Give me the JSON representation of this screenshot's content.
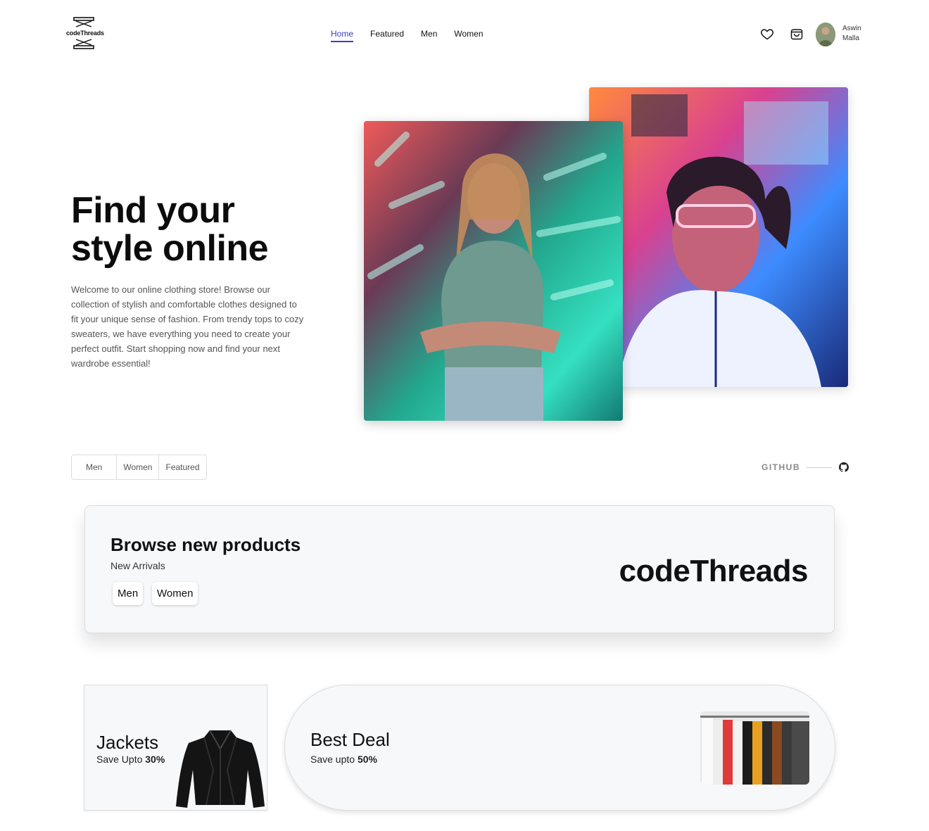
{
  "header": {
    "logo_text": "codeThreads",
    "nav": [
      "Home",
      "Featured",
      "Men",
      "Women"
    ],
    "active_nav": "Home",
    "icons": [
      "heart-icon",
      "shopping-bag-icon"
    ],
    "user": {
      "first": "Aswin",
      "last": "Malla"
    }
  },
  "hero": {
    "title_line1": "Find your",
    "title_line2": "style online",
    "description": "Welcome to our online clothing store! Browse our collection of stylish and comfortable clothes designed to fit your unique sense of fashion. From trendy tops to cozy sweaters, we have everything you need to create your perfect outfit. Start shopping now and find your next wardrobe essential!"
  },
  "filters": [
    "Men",
    "Women",
    "Featured"
  ],
  "github": {
    "label": "GITHUB",
    "icon": "github-icon"
  },
  "browse": {
    "title": "Browse new products",
    "subtitle": "New Arrivals",
    "buttons": [
      "Men",
      "Women"
    ],
    "brand": "codeThreads"
  },
  "jackets": {
    "title": "Jackets",
    "sub_prefix": "Save Upto",
    "sub_value": "30%"
  },
  "deal": {
    "title": "Best Deal",
    "sub_prefix": "Save upto",
    "sub_value": "50%"
  },
  "colors": {
    "accent": "#3d3dbd",
    "card_bg": "#f7f8fa"
  }
}
